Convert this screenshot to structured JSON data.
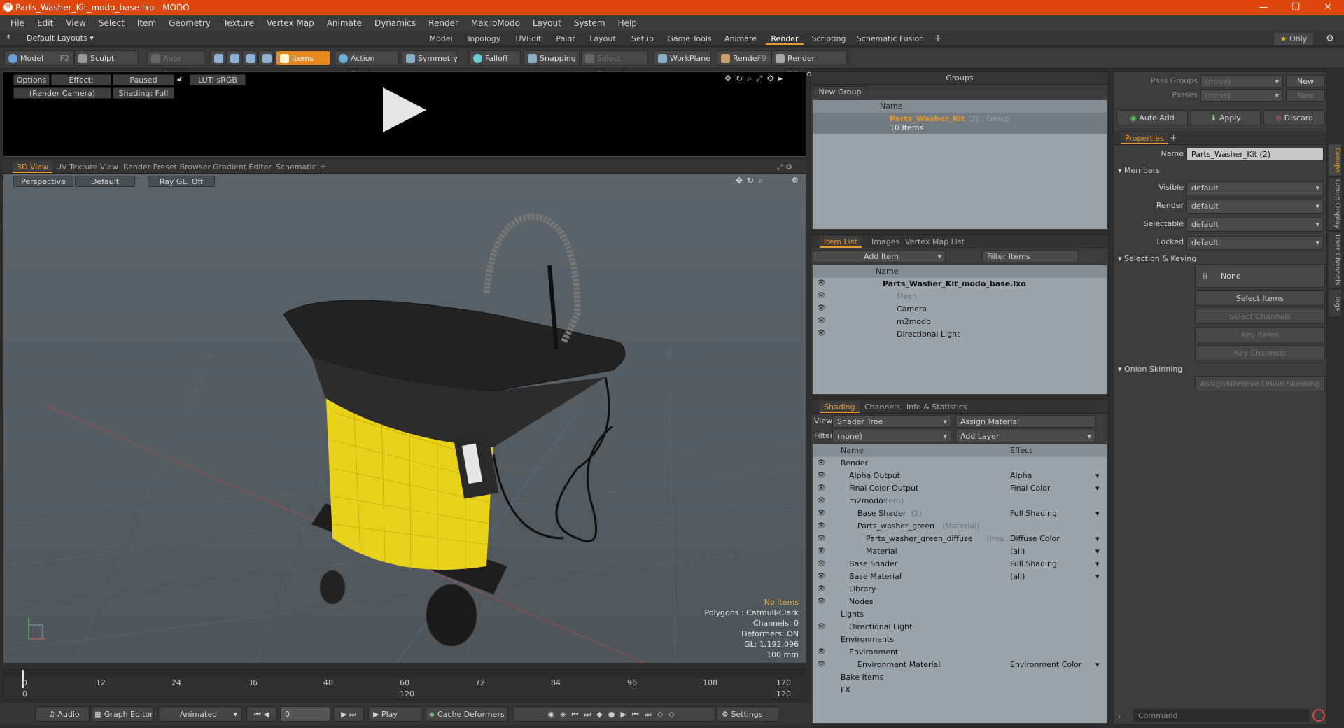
{
  "window": {
    "title": "Parts_Washer_Kit_modo_base.lxo - MODO",
    "controls": [
      "—",
      "❐",
      "✕"
    ]
  },
  "menu": [
    "File",
    "Edit",
    "View",
    "Select",
    "Item",
    "Geometry",
    "Texture",
    "Vertex Map",
    "Animate",
    "Dynamics",
    "Render",
    "MaxToModo",
    "Layout",
    "System",
    "Help"
  ],
  "layouts": {
    "dropdown": "Default Layouts",
    "tabs": [
      "Model",
      "Topology",
      "UVEdit",
      "Paint",
      "Layout",
      "Setup",
      "Game Tools",
      "Animate",
      "Render",
      "Scripting",
      "Schematic Fusion"
    ],
    "active": "Render",
    "only_label": "Only"
  },
  "toolbar": {
    "model": "Model",
    "model_key": "F2",
    "sculpt": "Sculpt",
    "auto_select": "Auto Select",
    "items": "Items",
    "action_center": "Action Center",
    "symmetry": "Symmetry",
    "falloff": "Falloff",
    "snapping": "Snapping",
    "select_through": "Select Through",
    "workplane": "WorkPlane",
    "render": "Render",
    "render_key": "F9",
    "render_window": "Render Window"
  },
  "render_view": {
    "options": "Options",
    "effect": "Effect: (Shadi...",
    "paused": "Paused",
    "lut": "LUT: sRGB",
    "camera": "(Render Camera)",
    "shading": "Shading: Full"
  },
  "viewport_tabs": [
    "3D View",
    "UV Texture View",
    "Render Preset Browser",
    "Gradient Editor",
    "Schematic"
  ],
  "viewport": {
    "perspective": "Perspective",
    "default": "Default",
    "raygl": "Ray GL: Off",
    "stats": {
      "no_items": "No Items",
      "polygons": "Polygons : Catmull-Clark",
      "channels": "Channels: 0",
      "deformers": "Deformers: ON",
      "gl": "GL: 1,192,096",
      "scale": "100 mm"
    }
  },
  "timeline": {
    "ticks": [
      "0",
      "12",
      "24",
      "36",
      "48",
      "60",
      "72",
      "84",
      "96",
      "108",
      "120"
    ],
    "sub_ticks": [
      "0",
      "120",
      "120"
    ]
  },
  "bottom": {
    "audio": "Audio",
    "graph_editor": "Graph Editor",
    "animated": "Animated",
    "frame": "0",
    "play": "Play",
    "cache": "Cache Deformers",
    "settings": "Settings"
  },
  "groups": {
    "title": "Groups",
    "new_group": "New Group",
    "col_name": "Name",
    "item_name": "Parts_Washer_Kit",
    "item_suffix": "(2) : Group",
    "item_count": "10 Items"
  },
  "item_list": {
    "tabs": [
      "Item List",
      "Images",
      "Vertex Map List"
    ],
    "add_item": "Add Item",
    "filter": "Filter Items",
    "col_name": "Name",
    "items": [
      {
        "label": "Parts_Washer_Kit_modo_base.lxo",
        "indent": 0,
        "bold": true
      },
      {
        "label": "Mesh",
        "indent": 1,
        "gray": true
      },
      {
        "label": "Camera",
        "indent": 1
      },
      {
        "label": "m2modo",
        "indent": 1
      },
      {
        "label": "Directional Light",
        "indent": 1
      }
    ]
  },
  "shading": {
    "tabs": [
      "Shading",
      "Channels",
      "Info & Statistics"
    ],
    "view_label": "View",
    "view_value": "Shader Tree",
    "assign_material": "Assign Material",
    "filter_label": "Filter",
    "filter_value": "(none)",
    "add_layer": "Add Layer",
    "col_name": "Name",
    "col_effect": "Effect",
    "rows": [
      {
        "name": "Render",
        "suffix": "",
        "effect": "",
        "indent": 0
      },
      {
        "name": "Alpha Output",
        "suffix": "",
        "effect": "Alpha",
        "indent": 1
      },
      {
        "name": "Final Color Output",
        "suffix": "",
        "effect": "Final Color",
        "indent": 1
      },
      {
        "name": "m2modo",
        "suffix": "(Item)",
        "effect": "",
        "indent": 1
      },
      {
        "name": "Base Shader",
        "suffix": "(2)",
        "effect": "Full Shading",
        "indent": 2
      },
      {
        "name": "Parts_washer_green",
        "suffix": "(Material)",
        "effect": "",
        "indent": 2
      },
      {
        "name": "Parts_washer_green_diffuse",
        "suffix": "(Ima...",
        "effect": "Diffuse Color",
        "indent": 3
      },
      {
        "name": "Material",
        "suffix": "",
        "effect": "(all)",
        "indent": 3
      },
      {
        "name": "Base Shader",
        "suffix": "",
        "effect": "Full Shading",
        "indent": 1
      },
      {
        "name": "Base Material",
        "suffix": "",
        "effect": "(all)",
        "indent": 1
      },
      {
        "name": "Library",
        "suffix": "",
        "effect": "",
        "indent": 1
      },
      {
        "name": "Nodes",
        "suffix": "",
        "effect": "",
        "indent": 1
      },
      {
        "name": "Lights",
        "suffix": "",
        "effect": "",
        "indent": 0
      },
      {
        "name": "Directional Light",
        "suffix": "",
        "effect": "",
        "indent": 1
      },
      {
        "name": "Environments",
        "suffix": "",
        "effect": "",
        "indent": 0
      },
      {
        "name": "Environment",
        "suffix": "",
        "effect": "",
        "indent": 1
      },
      {
        "name": "Environment Material",
        "suffix": "",
        "effect": "Environment Color",
        "indent": 2
      },
      {
        "name": "Bake Items",
        "suffix": "",
        "effect": "",
        "indent": 0
      },
      {
        "name": "FX",
        "suffix": "",
        "effect": "",
        "indent": 0
      }
    ]
  },
  "properties": {
    "pass_groups": "Pass Groups",
    "passes": "Passes",
    "none": "(none)",
    "new": "New",
    "auto_add": "Auto Add",
    "apply": "Apply",
    "discard": "Discard",
    "tab": "Properties",
    "name_label": "Name",
    "name_value": "Parts_Washer_Kit (2)",
    "members": "Members",
    "fields": [
      {
        "label": "Visible",
        "value": "default"
      },
      {
        "label": "Render",
        "value": "default"
      },
      {
        "label": "Selectable",
        "value": "default"
      },
      {
        "label": "Locked",
        "value": "default"
      }
    ],
    "sel_keying": "Selection & Keying",
    "none_btn": "None",
    "select_items": "Select Items",
    "select_channels": "Select Channels",
    "key_items": "Key Items",
    "key_channels": "Key Channels",
    "onion": "Onion Skinning",
    "assign_onion": "Assign/Remove Onion Skinning",
    "side_tabs": [
      "Groups",
      "Group Display",
      "User Channels",
      "Tags"
    ],
    "command": "Command"
  },
  "colors": {
    "accent": "#e89a2a",
    "title": "#e0470f",
    "yellow": "#e8d21a"
  }
}
